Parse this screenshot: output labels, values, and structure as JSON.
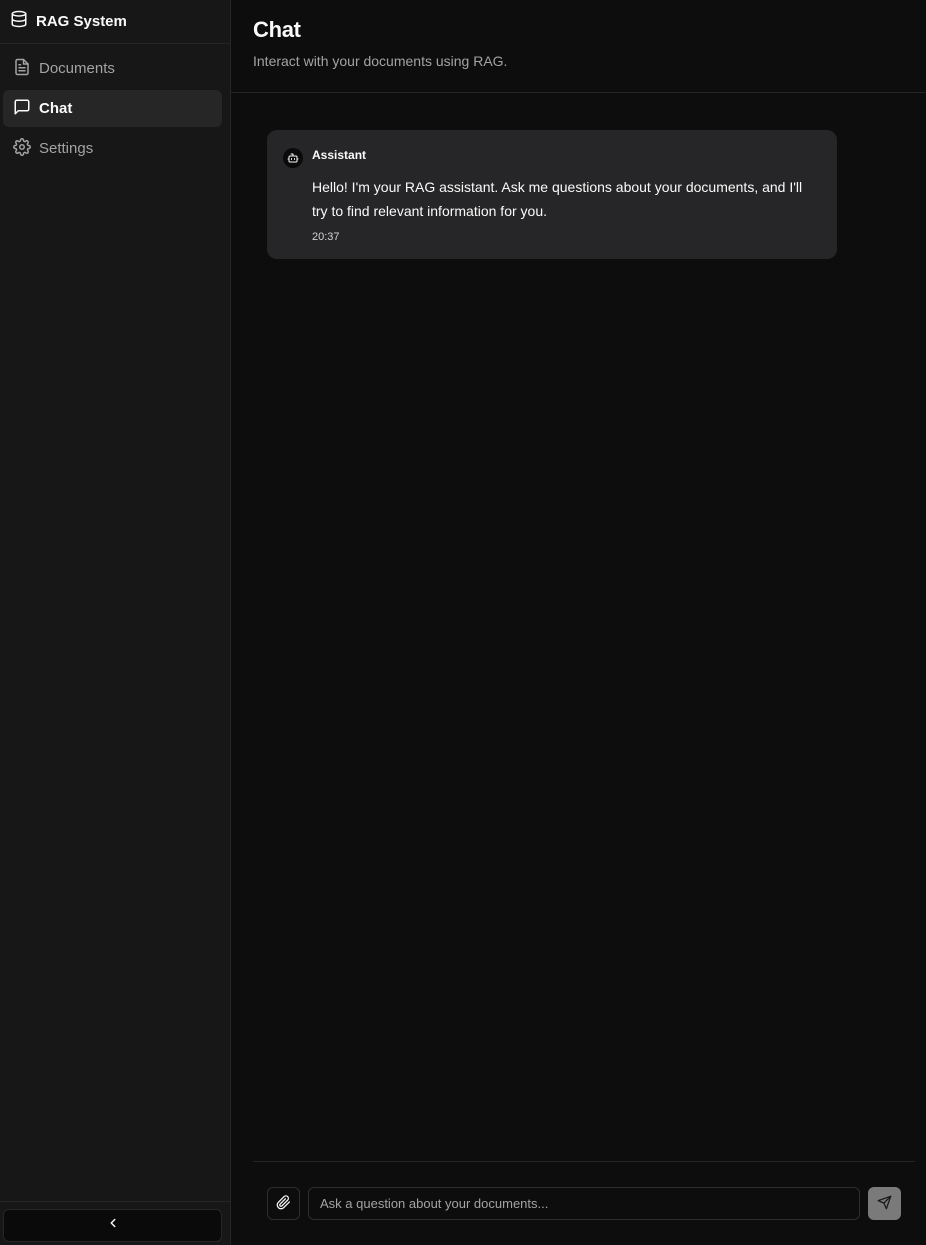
{
  "app": {
    "title": "RAG System",
    "icon": "database-icon"
  },
  "sidebar": {
    "items": [
      {
        "label": "Documents",
        "icon": "file-text-icon",
        "active": false
      },
      {
        "label": "Chat",
        "icon": "message-square-icon",
        "active": true
      },
      {
        "label": "Settings",
        "icon": "gear-icon",
        "active": false
      }
    ],
    "collapse_icon": "chevron-left-icon"
  },
  "header": {
    "title": "Chat",
    "subtitle": "Interact with your documents using RAG."
  },
  "messages": [
    {
      "author": "Assistant",
      "avatar_icon": "bot-icon",
      "text": "Hello! I'm your RAG assistant. Ask me questions about your documents, and I'll try to find relevant information for you.",
      "time": "20:37"
    }
  ],
  "composer": {
    "placeholder": "Ask a question about your documents...",
    "value": "",
    "attach_icon": "paperclip-icon",
    "send_icon": "send-icon"
  },
  "colors": {
    "background": "#0d0d0d",
    "sidebar": "#171717",
    "active_item": "#262626",
    "message_bubble": "#262628",
    "send_button": "#7a7a7a"
  }
}
